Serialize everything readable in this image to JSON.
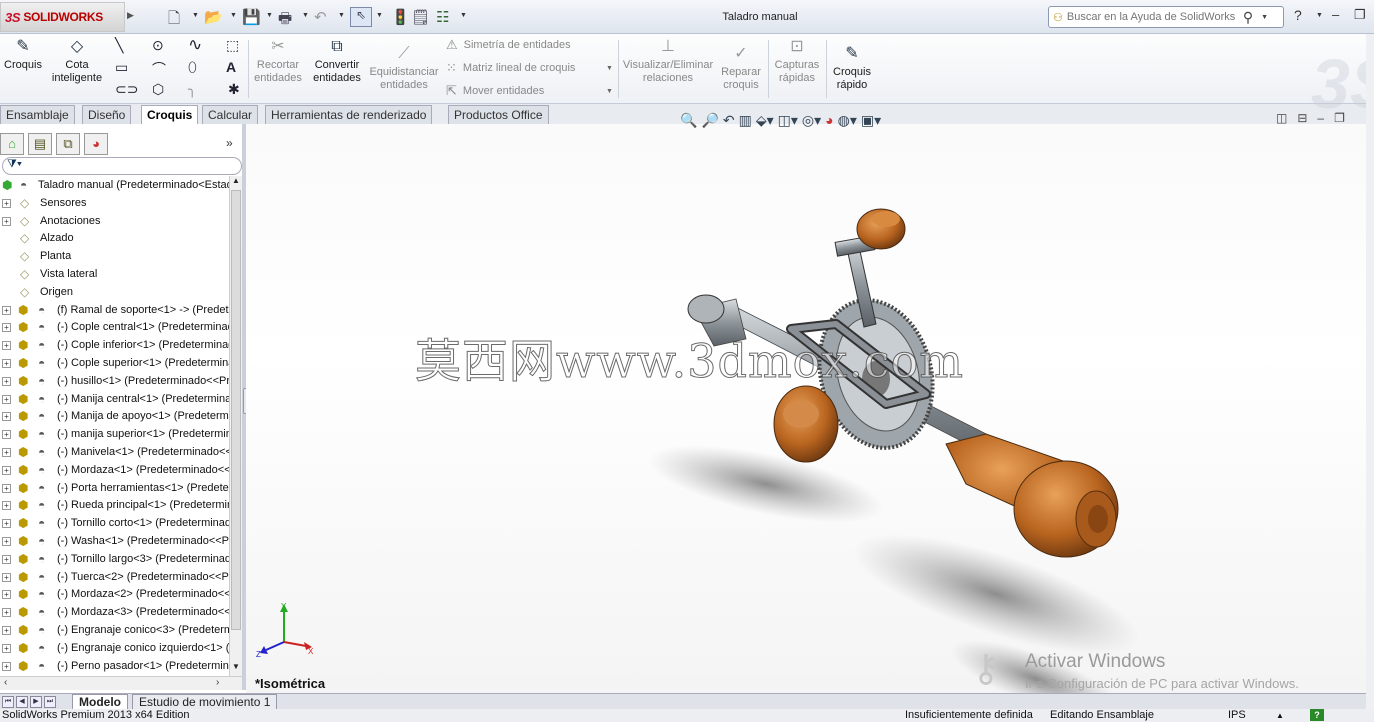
{
  "app": {
    "brand": "SOLIDWORKS",
    "doc_title": "Taladro manual"
  },
  "help": {
    "placeholder": "Buscar en la Ayuda de SolidWorks"
  },
  "ribbon": {
    "croquis": "Croquis",
    "cota1": "Cota",
    "cota2": "inteligente",
    "recortar1": "Recortar",
    "recortar2": "entidades",
    "convertir1": "Convertir",
    "convertir2": "entidades",
    "equid1": "Equidistanciar",
    "equid2": "entidades",
    "simetria": "Simetría de entidades",
    "matriz": "Matriz lineal de croquis",
    "mover": "Mover entidades",
    "visualizar1": "Visualizar/Eliminar",
    "visualizar2": "relaciones",
    "reparar1": "Reparar",
    "reparar2": "croquis",
    "capturas1": "Capturas",
    "capturas2": "rápidas",
    "rapido1": "Croquis",
    "rapido2": "rápido"
  },
  "tabs": [
    "Ensamblaje",
    "Diseño",
    "Croquis",
    "Calcular",
    "Herramientas de renderizado",
    "Productos Office"
  ],
  "active_tab": "Croquis",
  "tree": {
    "root": "Taladro manual  (Predeterminado<Estado",
    "items": [
      {
        "label": "Sensores",
        "icon": "sensor-icon"
      },
      {
        "label": "Anotaciones",
        "icon": "annotation-icon"
      },
      {
        "label": "Alzado",
        "icon": "plane-icon"
      },
      {
        "label": "Planta",
        "icon": "plane-icon"
      },
      {
        "label": "Vista lateral",
        "icon": "plane-icon"
      },
      {
        "label": "Origen",
        "icon": "origin-icon"
      }
    ],
    "components": [
      "(f) Ramal de soporte<1> -> (Predete",
      "(-) Cople central<1> (Predeterminad",
      "(-) Cople inferior<1> (Predeterminad",
      "(-) Cople superior<1> (Predetermina",
      "(-) husillo<1> (Predeterminado<<Pre",
      "(-) Manija central<1> (Predetermina",
      "(-) Manija de apoyo<1> (Predetermi",
      "(-) manija superior<1> (Predetermina",
      "(-) Manivela<1> (Predeterminado<<",
      "(-) Mordaza<1> (Predeterminado<<F",
      "(-) Porta herramientas<1> (Predeterm",
      "(-) Rueda principal<1> (Predetermin",
      "(-) Tornillo corto<1> (Predeterminad",
      "(-) Washa<1> (Predeterminado<<Pr",
      "(-) Tornillo largo<3> (Predeterminado",
      "(-) Tuerca<2> (Predeterminado<<Pr",
      "(-) Mordaza<2> (Predeterminado<<F",
      "(-) Mordaza<3> (Predeterminado<<F",
      "(-) Engranaje conico<3> (Predeterm",
      "(-) Engranaje conico izquierdo<1> (I",
      "(-) Perno pasador<1> (Predetermina"
    ]
  },
  "viewport": {
    "watermark": "莫西网www.3dmox.com",
    "view_label": "*Isométrica",
    "activate_title": "Activar Windows",
    "activate_sub": "Ir a Configuración de PC para activar Windows."
  },
  "bottom_tabs": [
    "Modelo",
    "Estudio de movimiento 1"
  ],
  "status": {
    "edition": "SolidWorks Premium 2013 x64 Edition",
    "definition": "Insuficientemente definida",
    "mode": "Editando Ensamblaje",
    "units": "IPS"
  },
  "colors": {
    "wood": "#b8641f",
    "steel": "#8e959a",
    "accent": "#c8102e"
  }
}
